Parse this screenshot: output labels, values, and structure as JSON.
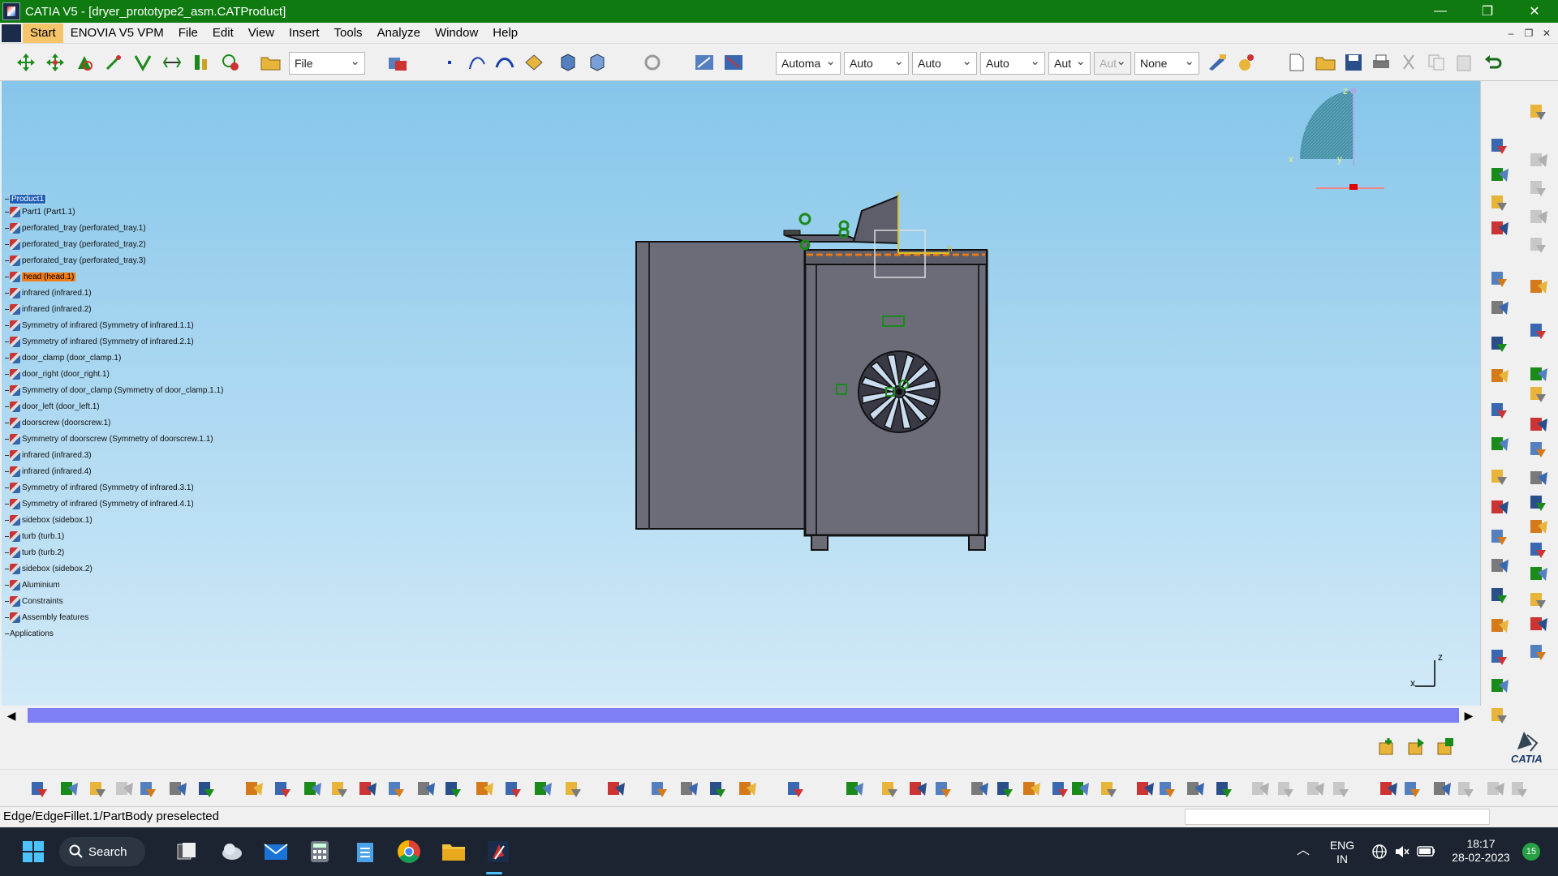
{
  "window": {
    "title": "CATIA V5 - [dryer_prototype2_asm.CATProduct]",
    "minimize": "—",
    "restore": "❐",
    "close": "✕"
  },
  "menu": {
    "items": [
      "Start",
      "ENOVIA V5 VPM",
      "File",
      "Edit",
      "View",
      "Insert",
      "Tools",
      "Analyze",
      "Window",
      "Help"
    ],
    "selected": "Start"
  },
  "mdi_buttons": [
    "–",
    "❐",
    "✕"
  ],
  "toolbar": {
    "file_combo": "File",
    "combos": [
      "Automa",
      "Auto",
      "Auto",
      "Auto",
      "Aut",
      "Aut",
      "None"
    ]
  },
  "tree": {
    "root": "Product1",
    "items": [
      {
        "label": "Part1 (Part1.1)"
      },
      {
        "label": "perforated_tray (perforated_tray.1)"
      },
      {
        "label": "perforated_tray (perforated_tray.2)"
      },
      {
        "label": "perforated_tray (perforated_tray.3)"
      },
      {
        "label": "head (head.1)",
        "selected": true
      },
      {
        "label": "infrared (infrared.1)"
      },
      {
        "label": "infrared (infrared.2)"
      },
      {
        "label": "Symmetry of infrared (Symmetry of infrared.1.1)"
      },
      {
        "label": "Symmetry of infrared (Symmetry of infrared.2.1)"
      },
      {
        "label": "door_clamp (door_clamp.1)"
      },
      {
        "label": "door_right (door_right.1)"
      },
      {
        "label": "Symmetry of door_clamp (Symmetry of door_clamp.1.1)"
      },
      {
        "label": "door_left (door_left.1)"
      },
      {
        "label": "doorscrew (doorscrew.1)"
      },
      {
        "label": "Symmetry of doorscrew (Symmetry of doorscrew.1.1)"
      },
      {
        "label": "infrared (infrared.3)"
      },
      {
        "label": "infrared (infrared.4)"
      },
      {
        "label": "Symmetry of infrared (Symmetry of infrared.3.1)"
      },
      {
        "label": "Symmetry of infrared (Symmetry of infrared.4.1)"
      },
      {
        "label": "sidebox (sidebox.1)"
      },
      {
        "label": "turb (turb.1)"
      },
      {
        "label": "turb (turb.2)"
      },
      {
        "label": "sidebox (sidebox.2)"
      },
      {
        "label": "Aluminium"
      },
      {
        "label": "Constraints"
      },
      {
        "label": "Assembly features"
      }
    ],
    "applications": "Applications"
  },
  "compass": {
    "z": "z",
    "x": "x",
    "y": "y"
  },
  "axis_triad": {
    "z": "z",
    "x": "x"
  },
  "status": {
    "text": "Edge/EdgeFillet.1/PartBody preselected"
  },
  "catia_logo": "CATIA",
  "taskbar": {
    "search": "Search",
    "lang1": "ENG",
    "lang2": "IN",
    "time": "18:17",
    "date": "28-02-2023",
    "notif": "15"
  },
  "colors": {
    "titlebar": "#0f7a0f",
    "selection": "#f07c1a",
    "tree_root": "#1f5fb4",
    "scrollbar": "#7f7ff5",
    "model_body": "#6b6c78"
  }
}
